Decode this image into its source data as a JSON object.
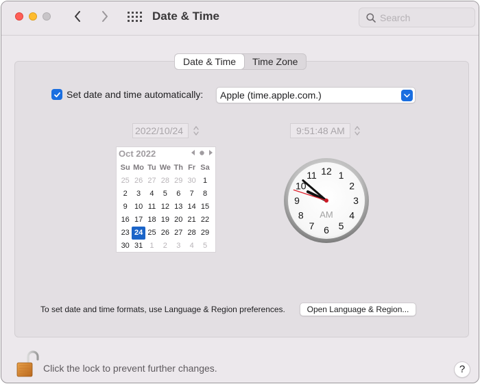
{
  "window": {
    "title": "Date & Time"
  },
  "search": {
    "placeholder": "Search"
  },
  "tabs": [
    {
      "label": "Date & Time",
      "active": true
    },
    {
      "label": "Time Zone",
      "active": false
    }
  ],
  "auto": {
    "checked": true,
    "label": "Set date and time automatically:",
    "server": "Apple (time.apple.com.)"
  },
  "date_field": "2022/10/24",
  "time_field": "9:51:48 AM",
  "calendar": {
    "month": "Oct 2022",
    "weekdays": [
      "Su",
      "Mo",
      "Tu",
      "We",
      "Th",
      "Fr",
      "Sa"
    ],
    "weeks": [
      [
        "25",
        "26",
        "27",
        "28",
        "29",
        "30",
        "1"
      ],
      [
        "2",
        "3",
        "4",
        "5",
        "6",
        "7",
        "8"
      ],
      [
        "9",
        "10",
        "11",
        "12",
        "13",
        "14",
        "15"
      ],
      [
        "16",
        "17",
        "18",
        "19",
        "20",
        "21",
        "22"
      ],
      [
        "23",
        "24",
        "25",
        "26",
        "27",
        "28",
        "29"
      ],
      [
        "30",
        "31",
        "1",
        "2",
        "3",
        "4",
        "5"
      ]
    ],
    "selected": "24"
  },
  "clock": {
    "numbers": [
      "12",
      "1",
      "2",
      "3",
      "4",
      "5",
      "6",
      "7",
      "8",
      "9",
      "10",
      "11"
    ],
    "meridiem": "AM",
    "time": {
      "hour": 9,
      "minute": 51,
      "second": 48
    }
  },
  "footer": {
    "formats_text": "To set date and time formats, use Language & Region preferences.",
    "open_button": "Open Language & Region...",
    "lock_text": "Click the lock to prevent further changes.",
    "help": "?"
  },
  "colors": {
    "accent": "#1a6ee0",
    "second_hand": "#e0202c",
    "window_bg": "#ece8ec"
  }
}
